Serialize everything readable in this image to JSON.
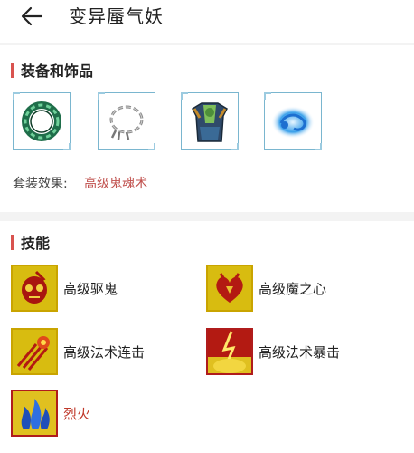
{
  "header": {
    "title": "变异蜃气妖",
    "back_icon": "arrow-left-icon"
  },
  "equipment_section": {
    "title": "装备和饰品",
    "items": [
      {
        "name": "jade-ring",
        "icon": "ring-icon"
      },
      {
        "name": "chain-bracelet",
        "icon": "chain-icon"
      },
      {
        "name": "demon-armor",
        "icon": "armor-icon"
      },
      {
        "name": "blue-cloud-charm",
        "icon": "cloud-icon"
      }
    ],
    "set_effect_label": "套装效果:",
    "set_effect_value": "高级鬼魂术"
  },
  "skills_section": {
    "title": "技能",
    "skills": [
      {
        "label": "高级驱鬼",
        "icon": "ghost-skull-icon"
      },
      {
        "label": "高级魔之心",
        "icon": "demon-heart-icon"
      },
      {
        "label": "高级法术连击",
        "icon": "spell-combo-icon"
      },
      {
        "label": "高级法术暴击",
        "icon": "spell-crit-icon"
      },
      {
        "label": "烈火",
        "icon": "flame-icon",
        "highlight_color": "#c0392b"
      }
    ]
  },
  "colors": {
    "accent": "#d9534f",
    "link": "#c0504d",
    "icon_border": "#7ab6cf",
    "skill_gold": "#d8bc10"
  }
}
